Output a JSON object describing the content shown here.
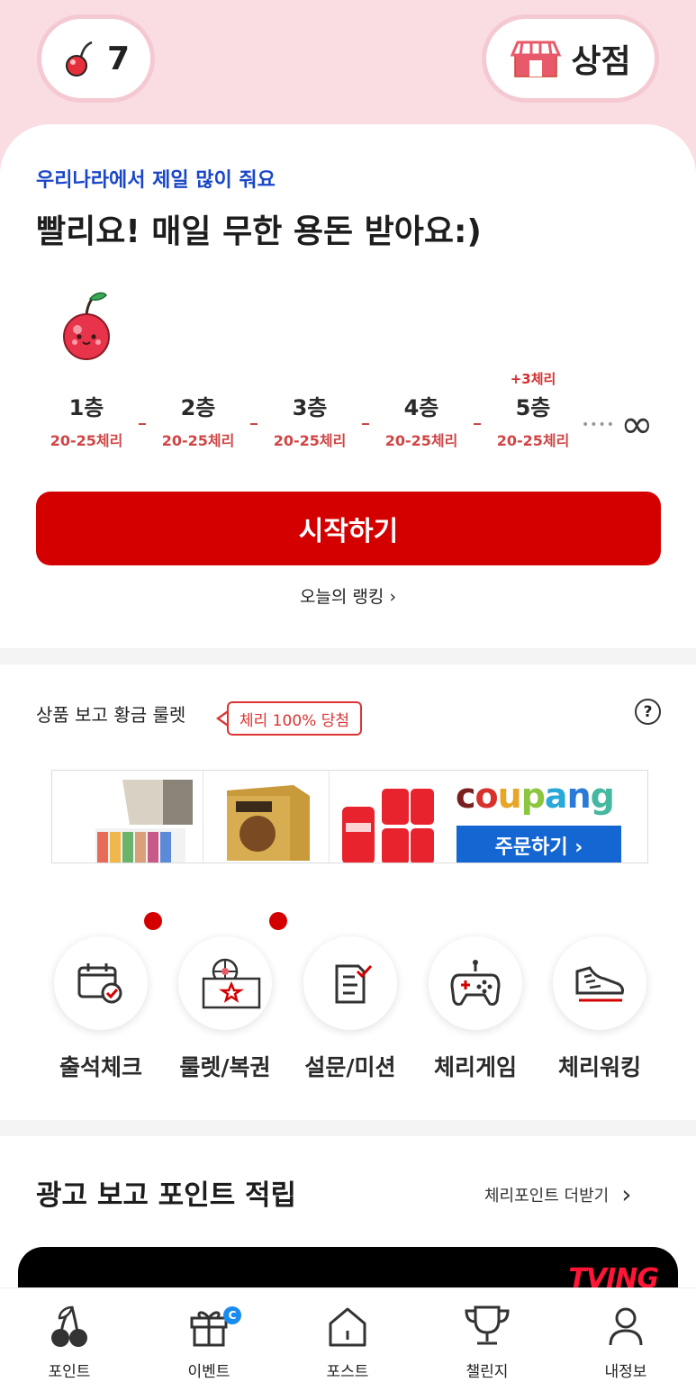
{
  "header": {
    "cherry_count": "7",
    "shop_label": "상점"
  },
  "promo": {
    "subtitle": "우리나라에서 제일 많이 줘요",
    "headline": "빨리요! 매일 무한 용돈 받아요:)",
    "floors": [
      {
        "name": "1층",
        "range": "20-25체리",
        "bonus": ""
      },
      {
        "name": "2층",
        "range": "20-25체리",
        "bonus": ""
      },
      {
        "name": "3층",
        "range": "20-25체리",
        "bonus": ""
      },
      {
        "name": "4층",
        "range": "20-25체리",
        "bonus": ""
      },
      {
        "name": "5층",
        "range": "20-25체리",
        "bonus": "+3체리"
      }
    ],
    "infinity_symbol": "∞",
    "start_label": "시작하기",
    "ranking_label": "오늘의 랭킹",
    "ranking_chevron": "›"
  },
  "roulette": {
    "title": "상품 보고 황금 룰렛",
    "badge": "체리 100% 당첨",
    "help": "?"
  },
  "ad_banner": {
    "brand": "coupang",
    "cta": "주문하기 ›"
  },
  "menu": {
    "items": [
      {
        "label": "출석체크",
        "icon": "calendar-check-icon",
        "dot": false
      },
      {
        "label": "룰렛/복권",
        "icon": "roulette-ticket-icon",
        "dot": true
      },
      {
        "label": "설문/미션",
        "icon": "survey-icon",
        "dot": true
      },
      {
        "label": "체리게임",
        "icon": "gamepad-icon",
        "dot": false
      },
      {
        "label": "체리워킹",
        "icon": "sneaker-icon",
        "dot": false
      }
    ]
  },
  "ad_points": {
    "title": "광고 보고 포인트 적립",
    "more_label": "체리포인트 더받기",
    "more_chevron": "›",
    "brand": "TVING"
  },
  "bottom_nav": {
    "items": [
      {
        "label": "포인트",
        "icon": "cherry-icon"
      },
      {
        "label": "이벤트",
        "icon": "gift-icon",
        "badge": "C"
      },
      {
        "label": "포스트",
        "icon": "home-icon"
      },
      {
        "label": "챌린지",
        "icon": "trophy-icon"
      },
      {
        "label": "내정보",
        "icon": "person-icon"
      }
    ]
  },
  "colors": {
    "primary_red": "#d40000",
    "top_pink": "#fadde3",
    "accent_blue": "#1a47c8",
    "coupang_blue": "#1466d2"
  }
}
